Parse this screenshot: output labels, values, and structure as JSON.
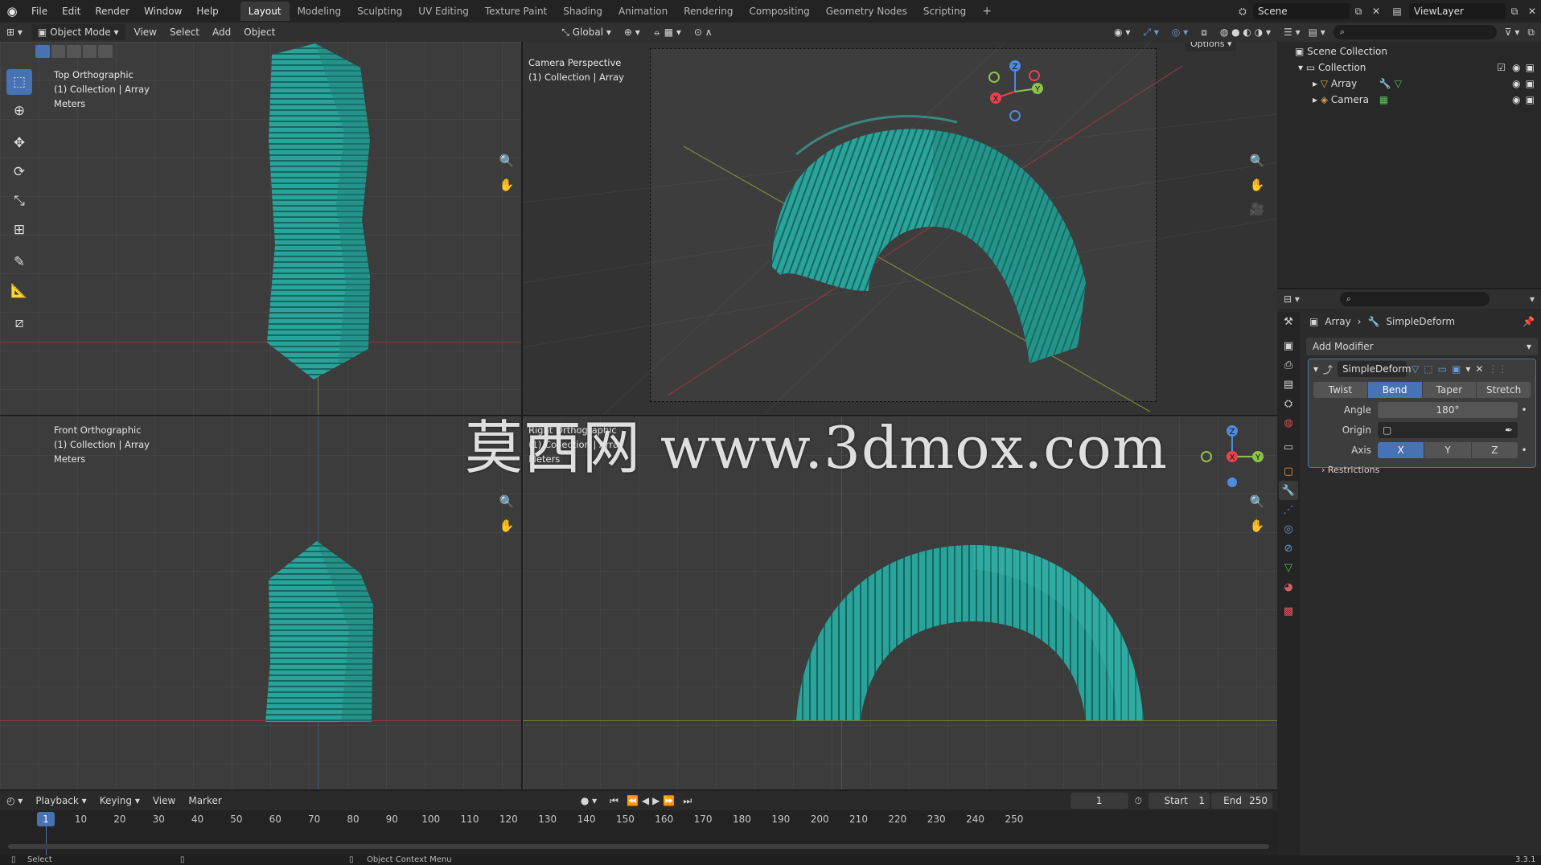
{
  "app": {
    "version": "3.3.1"
  },
  "topbar": {
    "menus": [
      "File",
      "Edit",
      "Render",
      "Window",
      "Help"
    ],
    "workspaces": [
      "Layout",
      "Modeling",
      "Sculpting",
      "UV Editing",
      "Texture Paint",
      "Shading",
      "Animation",
      "Rendering",
      "Compositing",
      "Geometry Nodes",
      "Scripting"
    ],
    "active_workspace": "Layout",
    "scene": "Scene",
    "view_layer": "ViewLayer"
  },
  "viewport_header": {
    "mode": "Object Mode",
    "menus": [
      "View",
      "Select",
      "Add",
      "Object"
    ],
    "transform_orientation": "Global",
    "options": "Options"
  },
  "viewports": {
    "top": {
      "line1": "Top Orthographic",
      "line2": "(1) Collection | Array",
      "line3": "Meters"
    },
    "camera": {
      "line1": "Camera Perspective",
      "line2": "(1) Collection | Array"
    },
    "front": {
      "line1": "Front Orthographic",
      "line2": "(1) Collection | Array",
      "line3": "Meters"
    },
    "right": {
      "line1": "Right Orthographic",
      "line2": "(1) Collection | Array",
      "line3": "Meters"
    }
  },
  "gizmo_axes": {
    "x": "X",
    "y": "Y",
    "z": "Z"
  },
  "outliner": {
    "root": "Scene Collection",
    "collection": "Collection",
    "items": [
      {
        "label": "Array"
      },
      {
        "label": "Camera"
      }
    ]
  },
  "properties": {
    "breadcrumb_object": "Array",
    "breadcrumb_modifier": "SimpleDeform",
    "add_modifier": "Add Modifier",
    "modifier_name": "SimpleDeform",
    "modes": [
      "Twist",
      "Bend",
      "Taper",
      "Stretch"
    ],
    "active_mode": "Bend",
    "angle_label": "Angle",
    "angle_value": "180°",
    "origin_label": "Origin",
    "axis_label": "Axis",
    "axes": [
      "X",
      "Y",
      "Z"
    ],
    "active_axis": "X",
    "restrictions": "Restrictions"
  },
  "timeline": {
    "menus": [
      "Playback",
      "Keying",
      "View",
      "Marker"
    ],
    "current_frame": "1",
    "start_label": "Start",
    "start": "1",
    "end_label": "End",
    "end": "250",
    "ticks": [
      "1",
      "10",
      "20",
      "30",
      "40",
      "50",
      "60",
      "70",
      "80",
      "90",
      "100",
      "110",
      "120",
      "130",
      "140",
      "150",
      "160",
      "170",
      "180",
      "190",
      "200",
      "210",
      "220",
      "230",
      "240",
      "250"
    ]
  },
  "statusbar": {
    "left": "Select",
    "middle": "Object Context Menu",
    "version": "3.3.1"
  },
  "watermark": "莫西网 www.3dmox.com",
  "colors": {
    "accent": "#4772b3",
    "mesh": "#2a9d96",
    "x_axis": "#e5434f",
    "y_axis": "#8bc34a",
    "z_axis": "#4f8ae0"
  }
}
